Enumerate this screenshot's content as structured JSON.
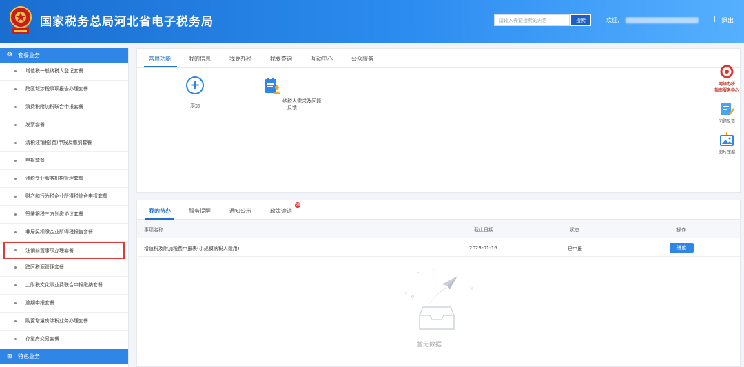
{
  "header": {
    "site_title": "国家税务总局河北省电子税务局",
    "search_placeholder": "请输入需要搜索的内容",
    "search_button": "搜索",
    "welcome": "欢迎,",
    "separator": "|",
    "logout": "退出",
    "brand_color": "#2c8cf0"
  },
  "sidebar": {
    "section_title": "套餐业务",
    "items": [
      {
        "label": "增值税一般纳税人登记套餐"
      },
      {
        "label": "跨区域涉税事项报告办理套餐"
      },
      {
        "label": "消费税附加税联合申报套餐"
      },
      {
        "label": "发票套餐"
      },
      {
        "label": "清税注销税(费)申报及缴纳套餐"
      },
      {
        "label": "申报套餐"
      },
      {
        "label": "涉税专业服务机构管理套餐"
      },
      {
        "label": "财产和行为税企业所得税综合申报套餐"
      },
      {
        "label": "签署银税三方划缴协议套餐"
      },
      {
        "label": "非居民扣缴企业所得税报告套餐"
      },
      {
        "label": "注销前置事项办理套餐"
      },
      {
        "label": "跨区税源管理套餐"
      },
      {
        "label": "土附税文化事业费联合申报缴纳套餐"
      },
      {
        "label": "逾期申报套餐"
      },
      {
        "label": "购置增量房涉税业务办理套餐"
      },
      {
        "label": "存量房交易套餐"
      }
    ],
    "selected_index": 10,
    "section2_title": "特色业务"
  },
  "top_panel": {
    "tabs": [
      "常用功能",
      "我的信息",
      "我要办税",
      "我要查询",
      "互动中心",
      "公众服务"
    ],
    "active_tab": 0,
    "functions": [
      {
        "label": "添加",
        "icon": "plus-icon"
      },
      {
        "label": "纳税人需求及问题反馈",
        "icon": "document-user-icon"
      }
    ]
  },
  "float_tools": [
    {
      "label": "网络办税\n指南服务中心",
      "icon": "service-center-icon"
    },
    {
      "label": "问题反馈",
      "icon": "feedback-icon"
    },
    {
      "label": "图片压缩",
      "icon": "image-compress-icon"
    }
  ],
  "bottom_panel": {
    "tabs": [
      "我的待办",
      "服务提醒",
      "通知公示",
      "政策速递"
    ],
    "active_tab": 0,
    "badge_count": "23",
    "columns": [
      "事项名称",
      "截止日期",
      "状态",
      "操作"
    ],
    "rows": [
      {
        "name": "增值税及附加税费申报表(小规模纳税人适用)",
        "deadline": "2023-01-16",
        "status": "已申报",
        "action": "进度"
      }
    ],
    "empty_text": "暂无数据"
  }
}
